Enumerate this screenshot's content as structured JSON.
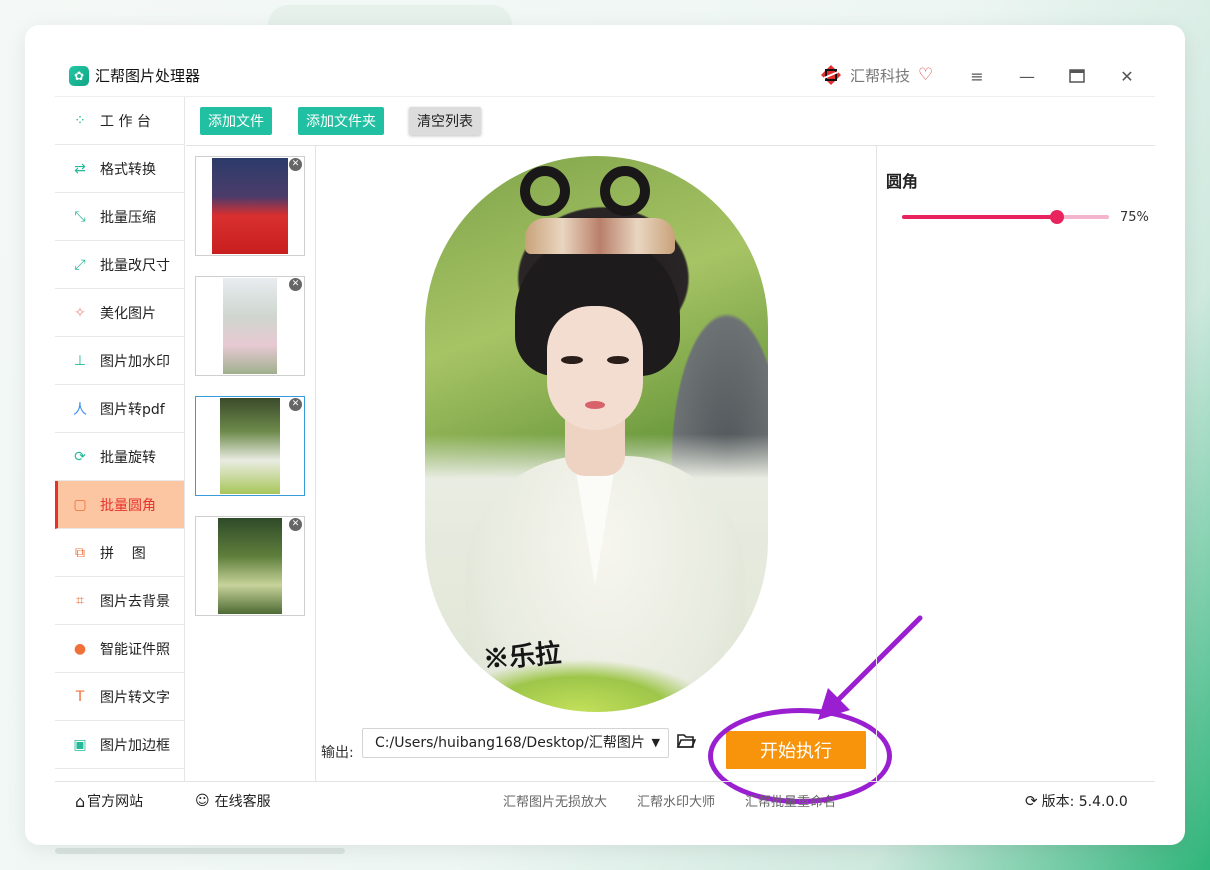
{
  "app": {
    "title": "汇帮图片处理器",
    "brand": "汇帮科技"
  },
  "toolbar": {
    "add_file": "添加文件",
    "add_folder": "添加文件夹",
    "clear_list": "清空列表"
  },
  "sidebar": {
    "items": [
      {
        "label": "工 作 台",
        "icon": "grid-icon",
        "active": false
      },
      {
        "label": "格式转换",
        "icon": "convert-icon",
        "active": false
      },
      {
        "label": "批量压缩",
        "icon": "compress-icon",
        "active": false
      },
      {
        "label": "批量改尺寸",
        "icon": "resize-icon",
        "active": false
      },
      {
        "label": "美化图片",
        "icon": "beautify-icon",
        "active": false
      },
      {
        "label": "图片加水印",
        "icon": "stamp-icon",
        "active": false
      },
      {
        "label": "图片转pdf",
        "icon": "pdf-icon",
        "active": false
      },
      {
        "label": "批量旋转",
        "icon": "rotate-icon",
        "active": false
      },
      {
        "label": "批量圆角",
        "icon": "rounded-corner-icon",
        "active": true
      },
      {
        "label": "拼    图",
        "icon": "puzzle-icon",
        "active": false
      },
      {
        "label": "图片去背景",
        "icon": "crop-icon",
        "active": false
      },
      {
        "label": "智能证件照",
        "icon": "person-icon",
        "active": false
      },
      {
        "label": "图片转文字",
        "icon": "text-icon",
        "active": false
      },
      {
        "label": "图片加边框",
        "icon": "frame-icon",
        "active": false
      }
    ]
  },
  "output": {
    "label": "输出:",
    "path": "C:/Users/huibang168/Desktop/汇帮图片"
  },
  "actions": {
    "start": "开始执行"
  },
  "settings": {
    "title": "圆角",
    "radius_percent": 75,
    "radius_label": "75%"
  },
  "statusbar": {
    "website": "官方网站",
    "support": "在线客服",
    "link1": "汇帮图片无损放大",
    "link2": "汇帮水印大师",
    "link3": "汇帮批量重命名",
    "version": "版本: 5.4.0.0"
  },
  "colors": {
    "accent": "#21c0a2",
    "active_bg": "#fcc6a3",
    "active_text": "#e6322d",
    "start_button": "#f7940c",
    "slider": "#e8245e",
    "annotation": "#9a1fd0"
  }
}
